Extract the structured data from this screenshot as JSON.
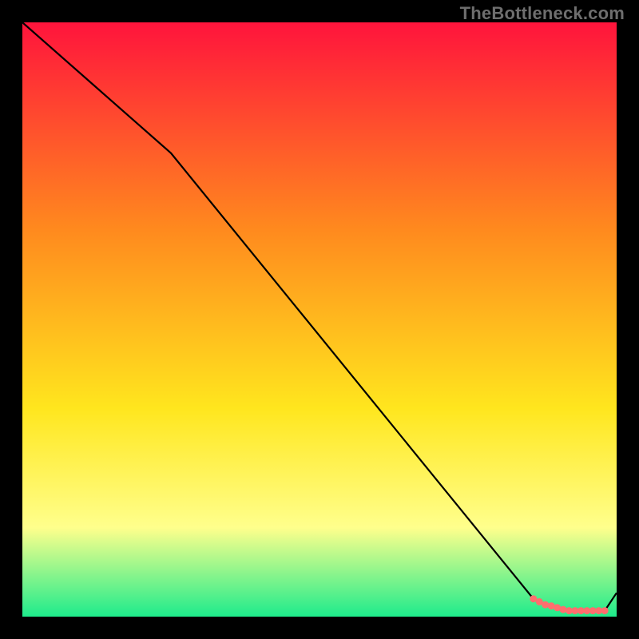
{
  "watermark": "TheBottleneck.com",
  "colors": {
    "bg": "#000000",
    "gradient_top": "#ff143c",
    "gradient_mid1": "#ff8a1e",
    "gradient_mid2": "#ffe61e",
    "gradient_mid3": "#ffff8c",
    "gradient_bottom": "#1eeb8c",
    "line": "#000000",
    "marker": "#ff6e6e"
  },
  "chart_data": {
    "type": "line",
    "title": "",
    "xlabel": "",
    "ylabel": "",
    "xlim": [
      0,
      100
    ],
    "ylim": [
      0,
      100
    ],
    "series": [
      {
        "name": "curve",
        "x": [
          0,
          25,
          86,
          88,
          90,
          92,
          94,
          98,
          100
        ],
        "y": [
          100,
          78,
          3,
          2,
          1.5,
          1,
          1,
          1,
          4
        ]
      }
    ],
    "markers": {
      "x": [
        86,
        87,
        88,
        89,
        90,
        91,
        92,
        93,
        94,
        95,
        96,
        97,
        98
      ],
      "y": [
        3,
        2.5,
        2,
        1.8,
        1.5,
        1.2,
        1,
        1,
        1,
        1,
        1,
        1,
        1
      ]
    }
  }
}
